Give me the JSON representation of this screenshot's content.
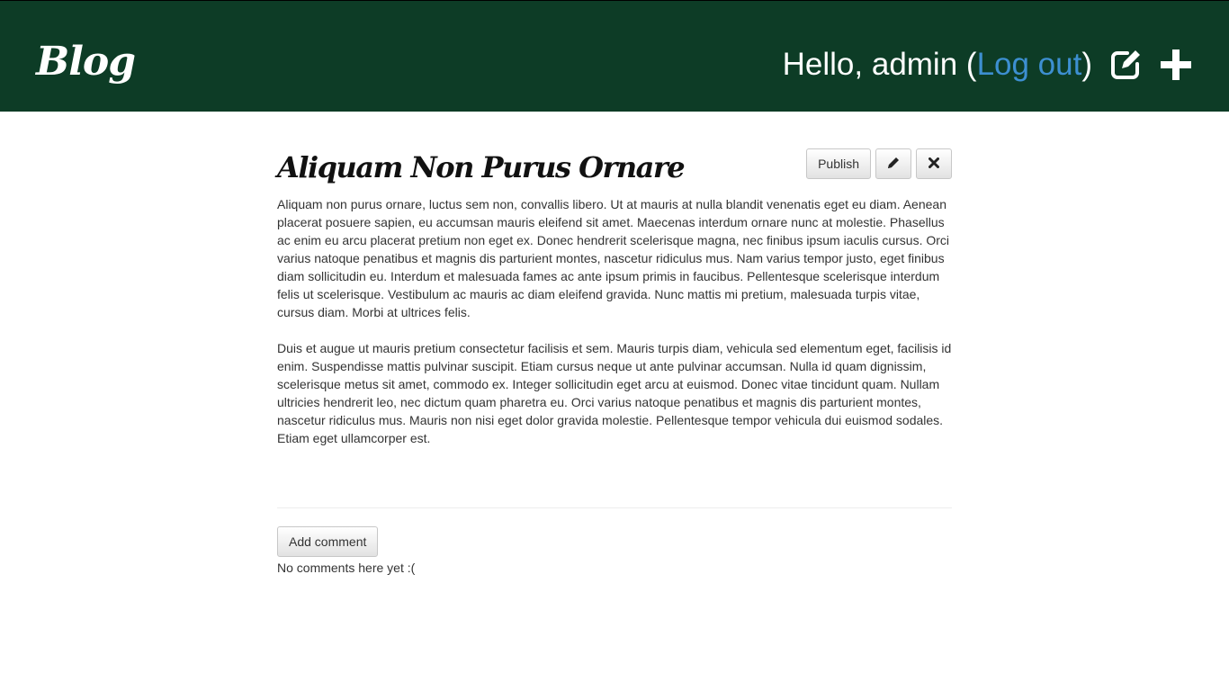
{
  "navbar": {
    "brand": "Blog",
    "greeting_prefix": "Hello, admin (",
    "logout_label": "Log out",
    "greeting_suffix": ")",
    "edit_icon": "edit-square-icon",
    "add_icon": "plus-icon"
  },
  "post": {
    "title": "Aliquam Non Purus Ornare",
    "publish_label": "Publish",
    "edit_icon": "pencil-icon",
    "delete_icon": "close-icon",
    "paragraphs": [
      "Aliquam non purus ornare, luctus sem non, convallis libero. Ut at mauris at nulla blandit venenatis eget eu diam. Aenean placerat posuere sapien, eu accumsan mauris eleifend sit amet. Maecenas interdum ornare nunc at molestie. Phasellus ac enim eu arcu placerat pretium non eget ex. Donec hendrerit scelerisque magna, nec finibus ipsum iaculis cursus. Orci varius natoque penatibus et magnis dis parturient montes, nascetur ridiculus mus. Nam varius tempor justo, eget finibus diam sollicitudin eu. Interdum et malesuada fames ac ante ipsum primis in faucibus. Pellentesque scelerisque interdum felis ut scelerisque. Vestibulum ac mauris ac diam eleifend gravida. Nunc mattis mi pretium, malesuada turpis vitae, cursus diam. Morbi at ultrices felis.",
      "Duis et augue ut mauris pretium consectetur facilisis et sem. Mauris turpis diam, vehicula sed elementum eget, facilisis id enim. Suspendisse mattis pulvinar suscipit. Etiam cursus neque ut ante pulvinar accumsan. Nulla id quam dignissim, scelerisque metus sit amet, commodo ex. Integer sollicitudin eget arcu at euismod. Donec vitae tincidunt quam. Nullam ultricies hendrerit leo, nec dictum quam pharetra eu. Orci varius natoque penatibus et magnis dis parturient montes, nascetur ridiculus mus. Mauris non nisi eget dolor gravida molestie. Pellentesque tempor vehicula dui euismod sodales. Etiam eget ullamcorper est."
    ]
  },
  "comments": {
    "add_label": "Add comment",
    "empty_text": "No comments here yet :("
  },
  "colors": {
    "navbar_bg": "#0d3c26",
    "link": "#3d8fd1"
  }
}
